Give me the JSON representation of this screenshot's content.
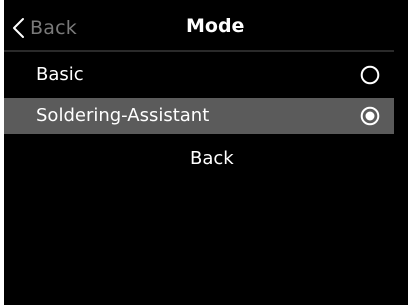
{
  "header": {
    "back_label": "Back",
    "back_icon": "chevron-left-icon",
    "title": "Mode"
  },
  "options": [
    {
      "label": "Basic",
      "selected": false
    },
    {
      "label": "Soldering-Assistant",
      "selected": true
    }
  ],
  "footer": {
    "back_label": "Back"
  },
  "colors": {
    "background": "#000000",
    "highlight": "#5b5b5b",
    "text": "#ffffff",
    "muted": "#7a7a7a"
  }
}
